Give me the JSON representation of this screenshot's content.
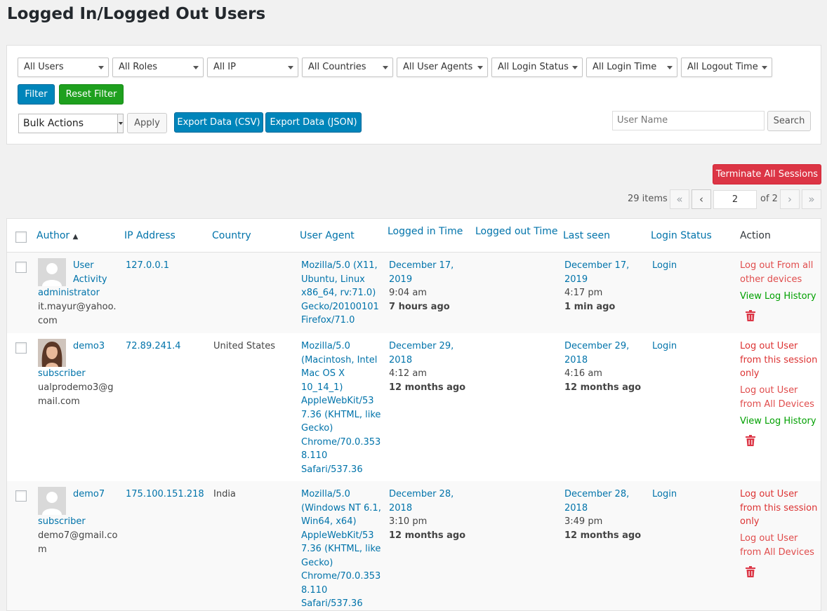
{
  "page": {
    "title": "Logged In/Logged Out Users"
  },
  "filters": {
    "dropdowns": [
      "All Users",
      "All Roles",
      "All IP",
      "All Countries",
      "All User Agents",
      "All Login Status",
      "All Login Time",
      "All Logout Time"
    ],
    "filter_label": "Filter",
    "reset_label": "Reset Filter",
    "bulk_actions": "Bulk Actions",
    "apply_label": "Apply",
    "export_csv_label": "Export Data (CSV)",
    "export_json_label": "Export Data (JSON)",
    "search_placeholder": "User Name",
    "search_label": "Search"
  },
  "toolbar": {
    "terminate_label": "Terminate All Sessions",
    "items_count": "29 items",
    "first": "«",
    "prev": "‹",
    "current_page": "2",
    "of_total": "of 2",
    "next": "›",
    "last": "»"
  },
  "table": {
    "headers": {
      "author": "Author",
      "sort_indicator": "▲",
      "ip": "IP Address",
      "country": "Country",
      "user_agent": "User Agent",
      "logged_in": "Logged in Time",
      "logged_out": "Logged out Time",
      "last_seen": "Last seen",
      "login_status": "Login Status",
      "action": "Action"
    },
    "rows": [
      {
        "name_lines": [
          "User",
          "Activity"
        ],
        "role": "administrator",
        "email_lines": [
          "it.mayur@yahoo.",
          "com"
        ],
        "ip": "127.0.0.1",
        "country": "",
        "ua_lines": [
          "Mozilla/5.0 (X11,",
          "Ubuntu, Linux",
          "x86_64, rv:71.0)",
          "Gecko/20100101",
          "Firefox/71.0"
        ],
        "login_date": [
          "December 17,",
          "2019"
        ],
        "login_time": "9:04 am",
        "login_ago": "7 hours ago",
        "seen_date": [
          "December 17,",
          "2019"
        ],
        "seen_time": "4:17 pm",
        "seen_ago": "1 min ago",
        "status": "Login",
        "actions": {
          "logout_all_lines": [
            "Log out From all",
            "other devices"
          ],
          "view_history": "View Log History"
        }
      },
      {
        "name_lines": [
          "demo3"
        ],
        "role": "subscriber",
        "email_lines": [
          "ualprodemo3@g",
          "mail.com"
        ],
        "ip": "72.89.241.4",
        "country": "United States",
        "ua_lines": [
          "Mozilla/5.0",
          "(Macintosh, Intel",
          "Mac OS X",
          "10_14_1)",
          "AppleWebKit/53",
          "7.36 (KHTML, like",
          "Gecko)",
          "Chrome/70.0.353",
          "8.110",
          "Safari/537.36"
        ],
        "login_date": [
          "December 29,",
          "2018"
        ],
        "login_time": "4:12 am",
        "login_ago": "12 months ago",
        "seen_date": [
          "December 29,",
          "2018"
        ],
        "seen_time": "4:16 am",
        "seen_ago": "12 months ago",
        "status": "Login",
        "actions": {
          "logout_session_lines": [
            "Log out User",
            "from this session",
            "only"
          ],
          "logout_devices_lines": [
            "Log out User",
            "from All Devices"
          ],
          "view_history": "View Log History"
        }
      },
      {
        "name_lines": [
          "demo7"
        ],
        "role": "subscriber",
        "email_lines": [
          "demo7@gmail.co",
          "m"
        ],
        "ip": "175.100.151.218",
        "country": "India",
        "ua_lines": [
          "Mozilla/5.0",
          "(Windows NT 6.1,",
          "Win64, x64)",
          "AppleWebKit/53",
          "7.36 (KHTML, like",
          "Gecko)",
          "Chrome/70.0.353",
          "8.110",
          "Safari/537.36"
        ],
        "login_date": [
          "December 28,",
          "2018"
        ],
        "login_time": "3:10 pm",
        "login_ago": "12 months ago",
        "seen_date": [
          "December 28,",
          "2018"
        ],
        "seen_time": "3:49 pm",
        "seen_ago": "12 months ago",
        "status": "Login",
        "actions": {
          "logout_session_lines": [
            "Log out User",
            "from this session",
            "only"
          ],
          "logout_devices_lines": [
            "Log out User",
            "from All Devices"
          ]
        }
      }
    ]
  },
  "colors": {
    "link": "#0073aa",
    "primary_button": "#0085ba",
    "reset_button": "#1ea01e",
    "terminate_button": "#dc3545",
    "logout_red": "#dc3232",
    "history_green": "#00a000"
  }
}
